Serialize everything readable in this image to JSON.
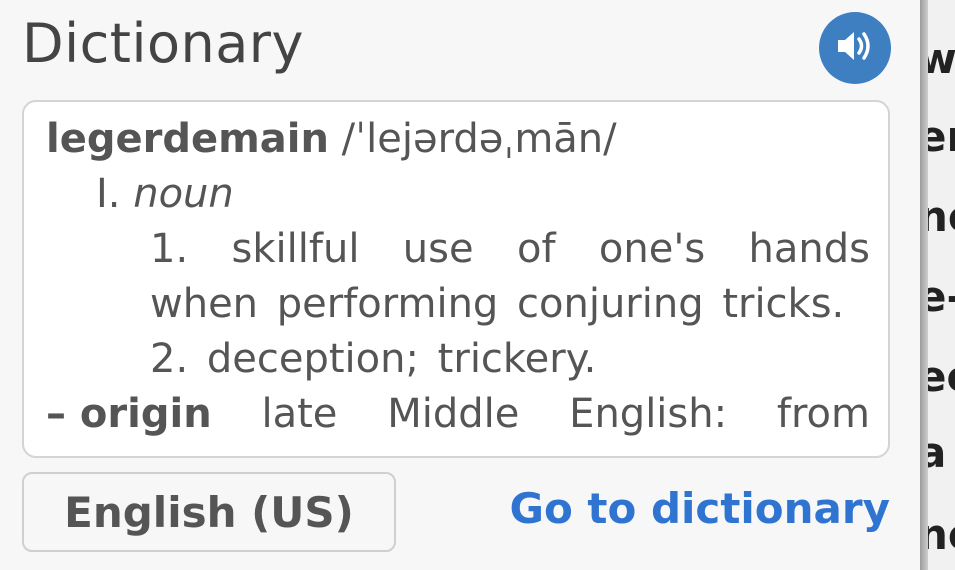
{
  "dictionary": {
    "title": "Dictionary",
    "speaker_icon": "speaker-icon",
    "entry": {
      "headword": "legerdemain",
      "pronunciation": "/ˈlejərdəˌmān/",
      "part_of_speech_numeral": "I.",
      "part_of_speech": "noun",
      "senses": [
        "1. skillful use of one's hands when performing conjuring tricks.",
        "2. deception; trickery."
      ],
      "origin_label": "– origin",
      "origin_words": [
        "late",
        "Middle",
        "English:",
        "from"
      ]
    },
    "language_button": "English (US)",
    "go_link": "Go to dictionary"
  },
  "background_page": {
    "fragments": [
      "w",
      "er",
      "ne",
      "e-",
      "ee",
      "a",
      "ne"
    ]
  },
  "colors": {
    "accent": "#3d7fc1",
    "link": "#2f74d0",
    "text": "#555555"
  }
}
